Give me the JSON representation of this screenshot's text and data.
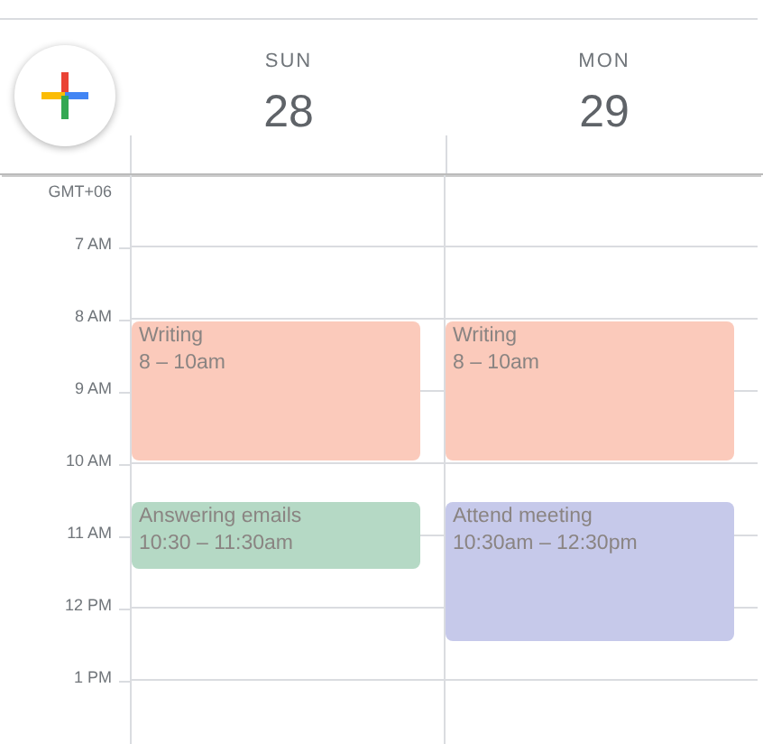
{
  "timezone": "GMT+06",
  "hours": [
    "7 AM",
    "8 AM",
    "9 AM",
    "10 AM",
    "11 AM",
    "12 PM",
    "1 PM"
  ],
  "days": [
    {
      "weekday": "SUN",
      "date": "28",
      "events": [
        {
          "title": "Writing",
          "time": "8 – 10am",
          "color": "#fbcabb"
        },
        {
          "title": "Answering emails",
          "time": "10:30 – 11:30am",
          "color": "#b5d9c5"
        }
      ]
    },
    {
      "weekday": "MON",
      "date": "29",
      "events": [
        {
          "title": "Writing",
          "time": "8 – 10am",
          "color": "#fbcabb"
        },
        {
          "title": "Attend meeting",
          "time": "10:30am – 12:30pm",
          "color": "#c6c9ea"
        }
      ]
    }
  ]
}
